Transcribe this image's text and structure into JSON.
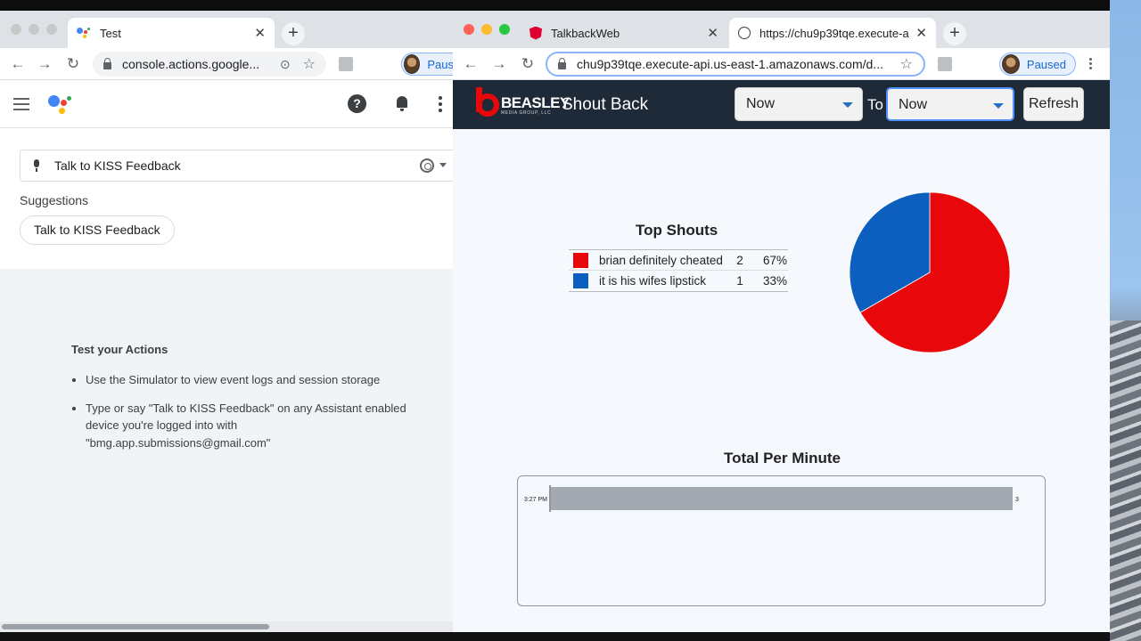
{
  "left_window": {
    "tab_title": "Test",
    "url": "console.actions.google...",
    "profile_label": "Paus",
    "simulator": {
      "input_value": "Talk to KISS Feedback",
      "suggestions_label": "Suggestions",
      "suggestion_chip": "Talk to KISS Feedback"
    },
    "test_section": {
      "title": "Test your Actions",
      "bullets": [
        "Use the Simulator to view event logs and session storage",
        "Type or say \"Talk to KISS Feedback\" on any Assistant enabled device you're logged into with \"bmg.app.submissions@gmail.com\""
      ]
    },
    "icons": [
      "menu-icon",
      "google-assistant-logo",
      "help-icon",
      "bell-icon",
      "more-vert-icon",
      "mic-icon",
      "target-icon"
    ]
  },
  "right_window": {
    "tabs": [
      {
        "title": "TalkbackWeb",
        "icon": "angular-icon"
      },
      {
        "title": "https://chu9p39tqe.execute-a",
        "icon": "globe-icon"
      }
    ],
    "url": "chu9p39tqe.execute-api.us-east-1.amazonaws.com/d...",
    "profile_label": "Paused",
    "app": {
      "logo_text": "BEASLEY",
      "logo_sub": "MEDIA GROUP, LLC",
      "title": "Shout Back",
      "from_select": "Now",
      "to_label": "To",
      "to_select": "Now",
      "refresh_label": "Refresh"
    },
    "colors": {
      "header_bg": "#1e2a37",
      "red": "#e8080b",
      "blue": "#0d5fbf",
      "bar_gray": "#a2a9b1"
    }
  },
  "chart_data": [
    {
      "type": "pie",
      "title": "Top Shouts",
      "series": [
        {
          "name": "brian definitely cheated",
          "count": "2",
          "percent": "67%",
          "value": 2,
          "color": "#e8080b"
        },
        {
          "name": "it is his wifes lipstick",
          "count": "1",
          "percent": "33%",
          "value": 1,
          "color": "#0d5fbf"
        }
      ]
    },
    {
      "type": "bar",
      "orientation": "horizontal",
      "title": "Total Per Minute",
      "categories": [
        "3:27 PM"
      ],
      "values": [
        3
      ],
      "value_labels": [
        "3"
      ],
      "xlim": [
        0,
        3
      ]
    }
  ]
}
